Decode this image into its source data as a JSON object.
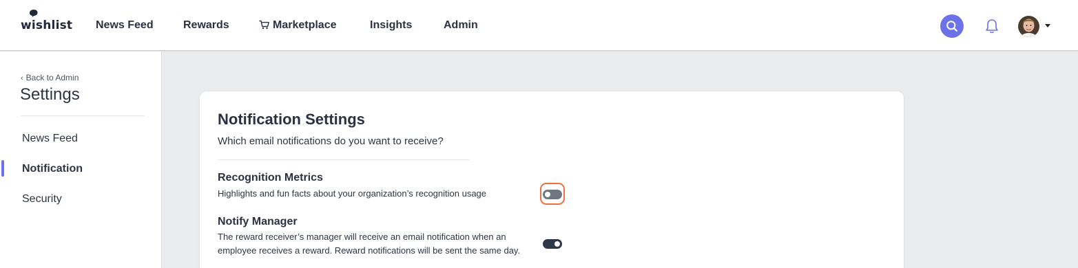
{
  "header": {
    "logo_text": "wishlist",
    "nav": [
      {
        "label": "News Feed"
      },
      {
        "label": "Rewards"
      },
      {
        "label": "Marketplace",
        "icon": "cart-icon"
      },
      {
        "label": "Insights"
      },
      {
        "label": "Admin"
      }
    ],
    "search_icon": "search-icon",
    "notifications_icon": "bell-icon",
    "accent_color": "#6d72e8"
  },
  "sidebar": {
    "back_label": "Back to Admin",
    "title": "Settings",
    "items": [
      {
        "label": "News Feed",
        "active": false
      },
      {
        "label": "Notification",
        "active": true
      },
      {
        "label": "Security",
        "active": false
      }
    ]
  },
  "main": {
    "title": "Notification Settings",
    "subtitle": "Which email notifications do you want to receive?",
    "settings": [
      {
        "title": "Recognition Metrics",
        "description": "Highlights and fun facts about your organization’s recognition usage",
        "enabled": false,
        "focused": true
      },
      {
        "title": "Notify Manager",
        "description": "The reward receiver’s manager will receive an email notification when an employee receives a reward. Reward notifications will be sent the same day.",
        "enabled": true,
        "focused": false
      }
    ],
    "focus_color": "#ef6f3f"
  }
}
